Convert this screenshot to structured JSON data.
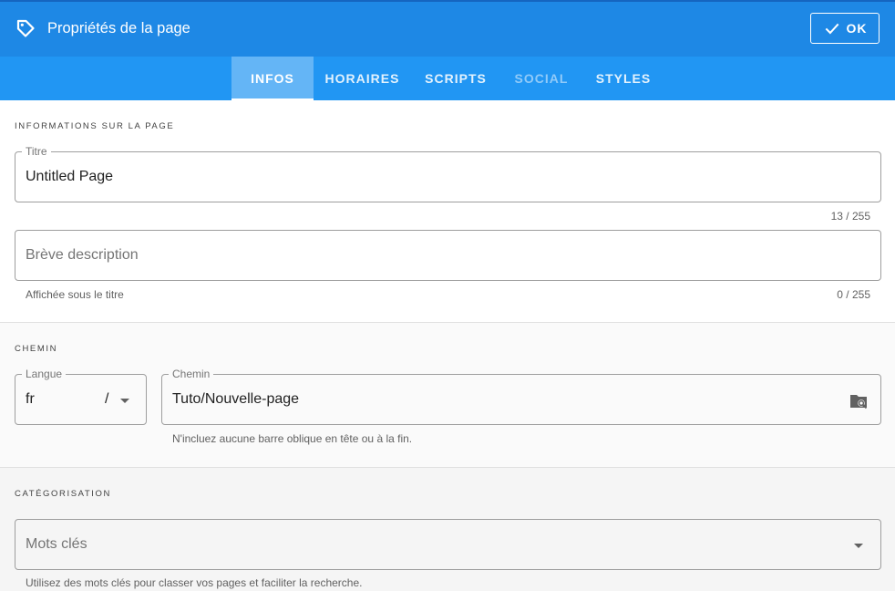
{
  "header": {
    "title": "Propriétés de la page",
    "ok_label": "OK"
  },
  "tabs": [
    {
      "label": "INFOS",
      "state": "active"
    },
    {
      "label": "HORAIRES",
      "state": "normal"
    },
    {
      "label": "SCRIPTS",
      "state": "normal"
    },
    {
      "label": "SOCIAL",
      "state": "disabled"
    },
    {
      "label": "STYLES",
      "state": "normal"
    }
  ],
  "info": {
    "section_title": "INFORMATIONS SUR LA PAGE",
    "title_field": {
      "label": "Titre",
      "value": "Untitled Page",
      "counter": "13 / 255"
    },
    "description_field": {
      "placeholder": "Brève description",
      "hint": "Affichée sous le titre",
      "counter": "0 / 255"
    }
  },
  "path": {
    "section_title": "CHEMIN",
    "locale_field": {
      "label": "Langue",
      "value": "fr",
      "separator": "/"
    },
    "path_field": {
      "label": "Chemin",
      "value": "Tuto/Nouvelle-page",
      "hint": "N'incluez aucune barre oblique en tête ou à la fin."
    }
  },
  "categorization": {
    "section_title": "CATÉGORISATION",
    "tags_field": {
      "placeholder": "Mots clés",
      "hint": "Utilisez des mots clés pour classer vos pages et faciliter la recherche."
    }
  },
  "icons": {
    "header": "tag-icon",
    "ok": "check-icon",
    "path_browse": "folder-search-icon",
    "dropdown": "chevron-down-icon"
  },
  "colors": {
    "header": "#1e88e5",
    "tabs": "#2196f3",
    "active_tab": "#64b5f6"
  }
}
